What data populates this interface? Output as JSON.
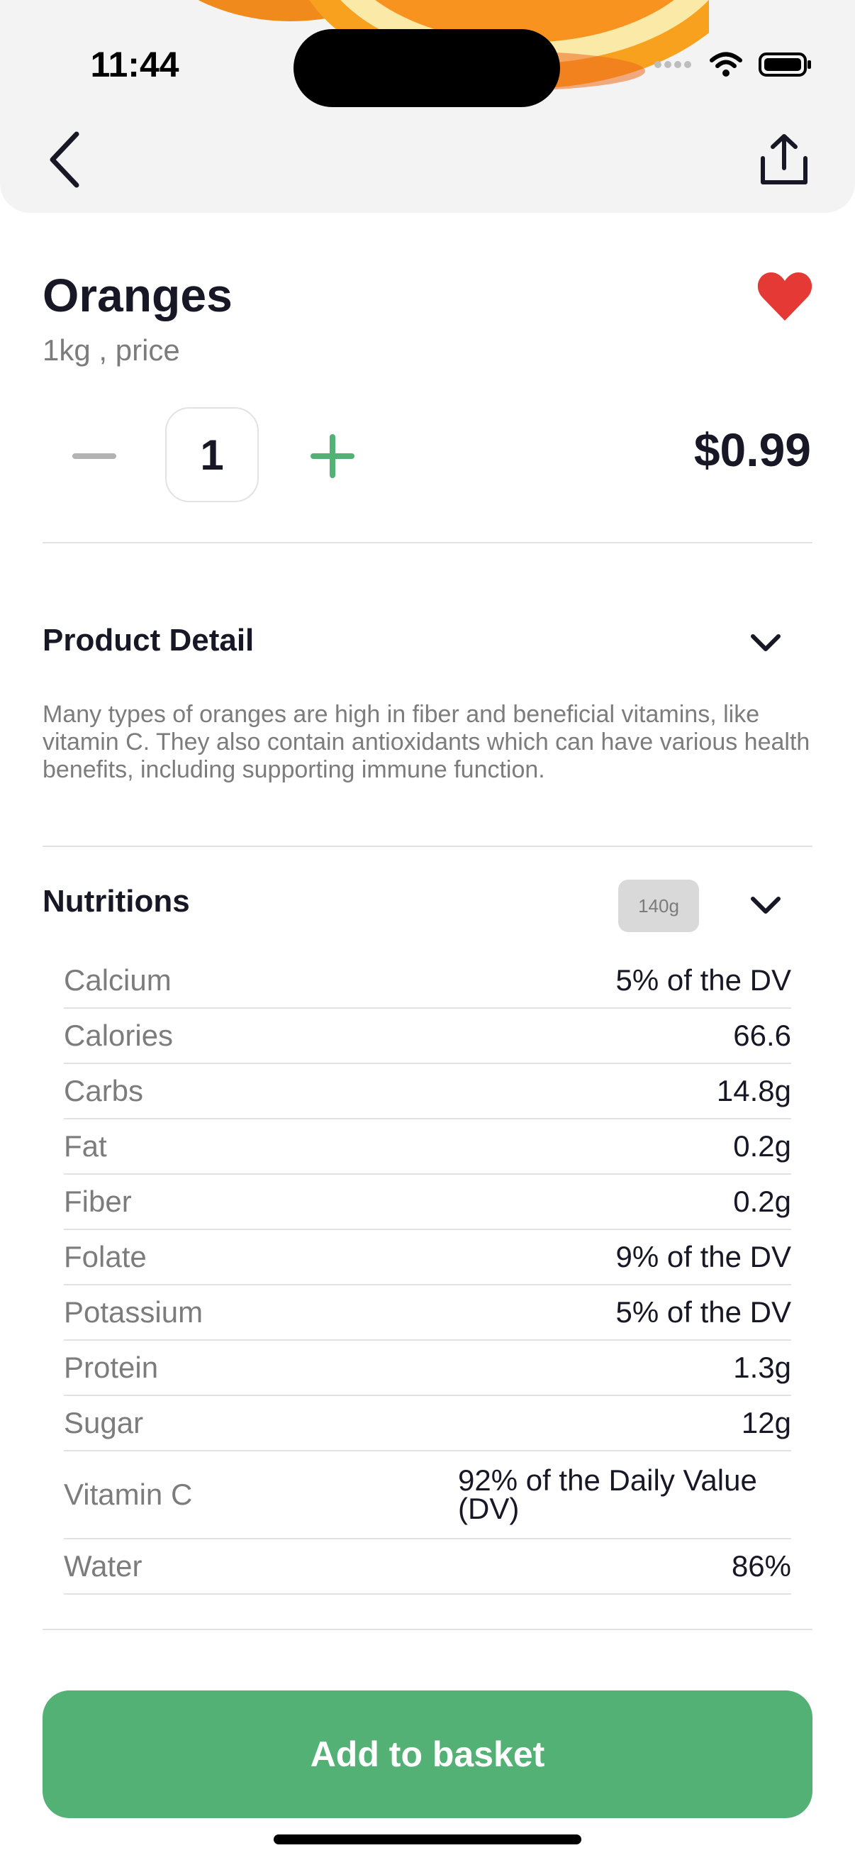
{
  "status_bar": {
    "time": "11:44"
  },
  "icons": {
    "back": "chevron-left-icon",
    "share": "share-icon",
    "favorite": "heart-icon",
    "minus": "minus-icon",
    "plus": "plus-icon",
    "chevron": "chevron-down-icon"
  },
  "product": {
    "name": "Oranges",
    "unit": "1kg , price",
    "quantity": "1",
    "price": "$0.99"
  },
  "detail": {
    "title": "Product Detail",
    "description": "Many types of oranges are high in fiber and beneficial vitamins, like vitamin C. They also contain antioxidants which can have various health benefits, including supporting immune function."
  },
  "nutrition": {
    "title": "Nutritions",
    "badge": "140g",
    "items": [
      {
        "label": "Calcium",
        "value": "5% of the DV"
      },
      {
        "label": "Calories",
        "value": "66.6"
      },
      {
        "label": "Carbs",
        "value": "14.8g"
      },
      {
        "label": "Fat",
        "value": "0.2g"
      },
      {
        "label": "Fiber",
        "value": "0.2g"
      },
      {
        "label": "Folate",
        "value": "9% of the DV"
      },
      {
        "label": "Potassium",
        "value": "5% of the DV"
      },
      {
        "label": "Protein",
        "value": "1.3g"
      },
      {
        "label": "Sugar",
        "value": "12g"
      },
      {
        "label": "Vitamin C",
        "value": "92% of the Daily Value (DV)"
      },
      {
        "label": "Water",
        "value": "86%"
      }
    ]
  },
  "cta": {
    "label": "Add to basket"
  },
  "colors": {
    "accent": "#53B175",
    "heart": "#E53935",
    "text": "#181725",
    "muted": "#7C7C7C",
    "hero_bg": "#F2F3F2"
  }
}
